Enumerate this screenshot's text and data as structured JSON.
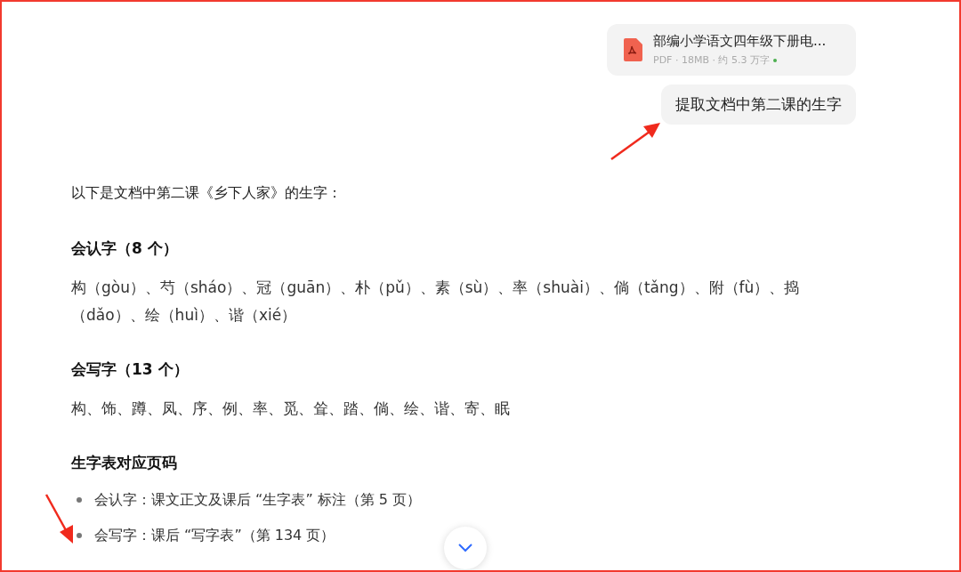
{
  "file_card": {
    "name": "部编小学语文四年级下册电...",
    "meta": "PDF · 18MB · 约 5.3 万字"
  },
  "user_message": "提取文档中第二课的生字",
  "answer": {
    "intro": "以下是文档中第二课《乡下人家》的生字：",
    "sections": [
      {
        "kind": "paragraph",
        "heading": "会认字（8 个）",
        "text": "构（gòu）、芍（sháo）、冠（guān）、朴（pǔ）、素（sù）、率（shuài）、倘（tǎng）、附（fù）、捣（dǎo）、绘（huì）、谐（xié）"
      },
      {
        "kind": "paragraph",
        "heading": "会写字（13 个）",
        "text": "构、饰、蹲、凤、序、例、率、觅、耸、踏、倘、绘、谐、寄、眠"
      },
      {
        "kind": "list",
        "heading": "生字表对应页码",
        "items": [
          "会认字：课文正文及课后 “生字表” 标注（第 5 页）",
          "会写字：课后 “写字表”（第 134 页）"
        ]
      }
    ]
  }
}
